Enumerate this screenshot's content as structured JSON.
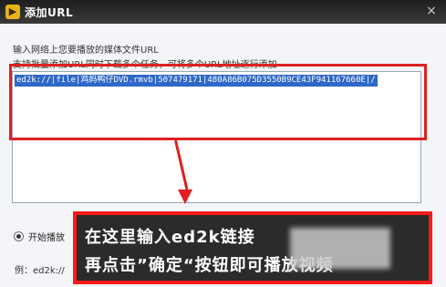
{
  "window": {
    "title": "添加URL",
    "close_glyph": "×"
  },
  "dialog": {
    "prompt": "输入网络上您要播放的媒体文件URL",
    "hint": "支持批量添加URL同时下载多个任务，可将多个URL地址逐行添加",
    "url_value": "ed2k://|file|鸡妈鸭仔DVD.rmvb|507479171|480A86B075D3550B9CE43F941167660E|/",
    "start_option": "开始播放",
    "example_prefix": "例：ed2k://"
  },
  "callout": {
    "line1": "在这里输入ed2k链接",
    "line2": "再点击”确定“按钮即可播放视频"
  },
  "colors": {
    "accent": "#e02020",
    "selection": "#2f68c8",
    "titlebar": "#2a2a2a"
  }
}
